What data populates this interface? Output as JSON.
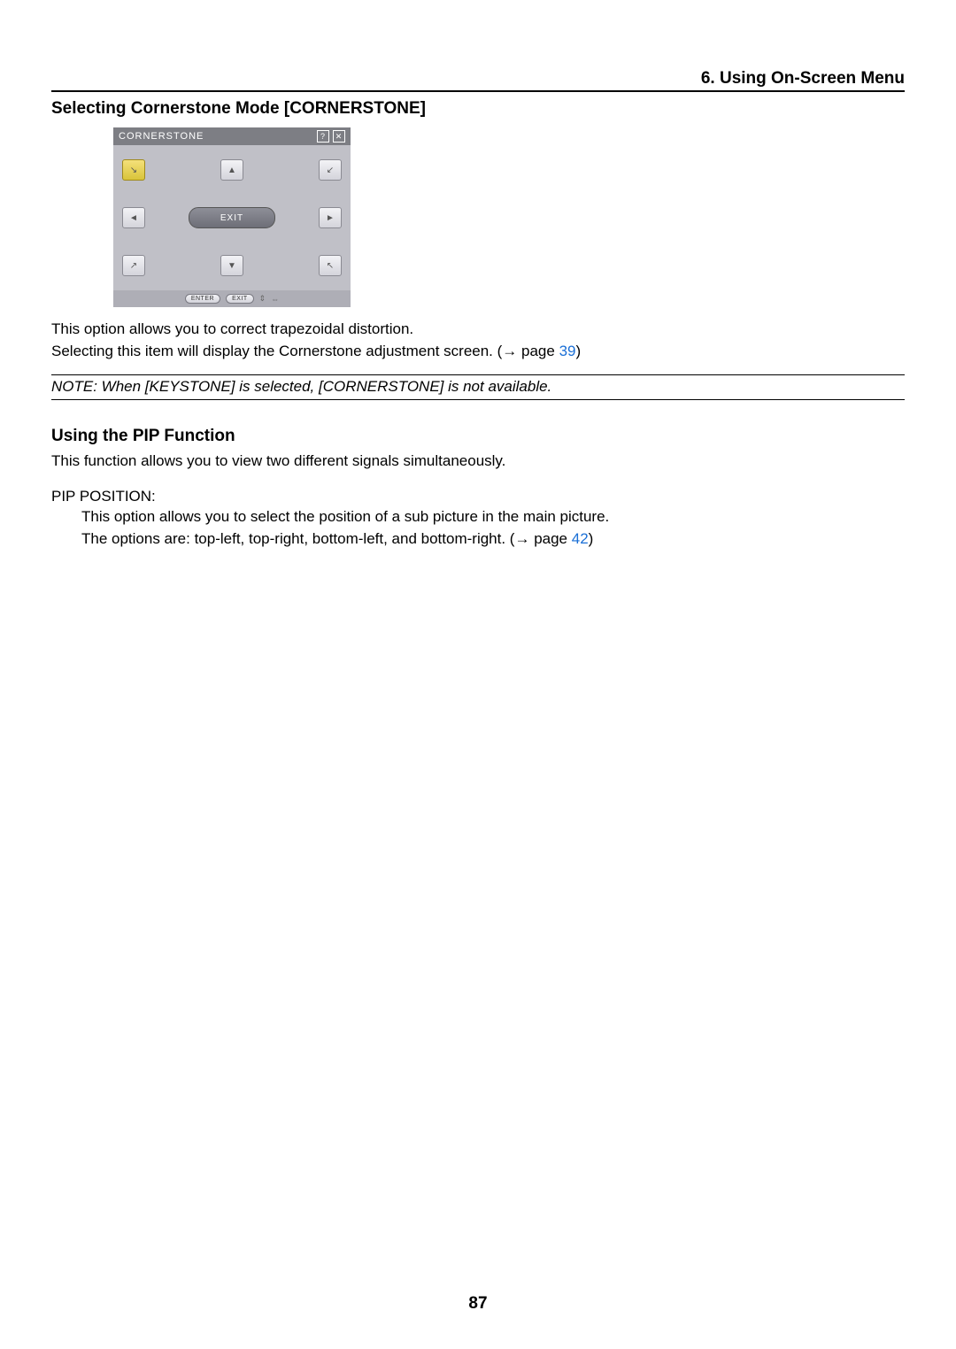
{
  "chapter": "6. Using On-Screen Menu",
  "section1": {
    "title": "Selecting Cornerstone Mode [CORNERSTONE]",
    "osd": {
      "title": "CORNERSTONE",
      "help_icon": "?",
      "close_icon": "✕",
      "exit_label": "EXIT",
      "footer_enter": "ENTER",
      "footer_exit": "EXIT",
      "footer_updown": "⇕",
      "footer_leftright": "⇔",
      "arrows": {
        "tl": "↘",
        "tc": "▲",
        "tr": "↙",
        "ml": "◄",
        "mr": "►",
        "bl": "↗",
        "bc": "▼",
        "br": "↖"
      }
    },
    "para1": "This option allows you to correct trapezoidal distortion.",
    "para2_a": "Selecting this item will display the Cornerstone adjustment screen. (",
    "para2_arrow": "→",
    "para2_b": " page ",
    "para2_link": "39",
    "para2_c": ")",
    "note": "NOTE: When [KEYSTONE] is selected, [CORNERSTONE] is not available."
  },
  "section2": {
    "title": "Using the PIP Function",
    "para": "This function allows you to view two different signals simultaneously.",
    "pip_label": "PIP POSITION:",
    "pip_desc1": "This option allows you to select the position of a sub picture in the main picture.",
    "pip_desc2_a": "The options are: top-left, top-right, bottom-left, and bottom-right. (",
    "pip_desc2_arrow": "→",
    "pip_desc2_b": " page ",
    "pip_desc2_link": "42",
    "pip_desc2_c": ")"
  },
  "page_number": "87"
}
